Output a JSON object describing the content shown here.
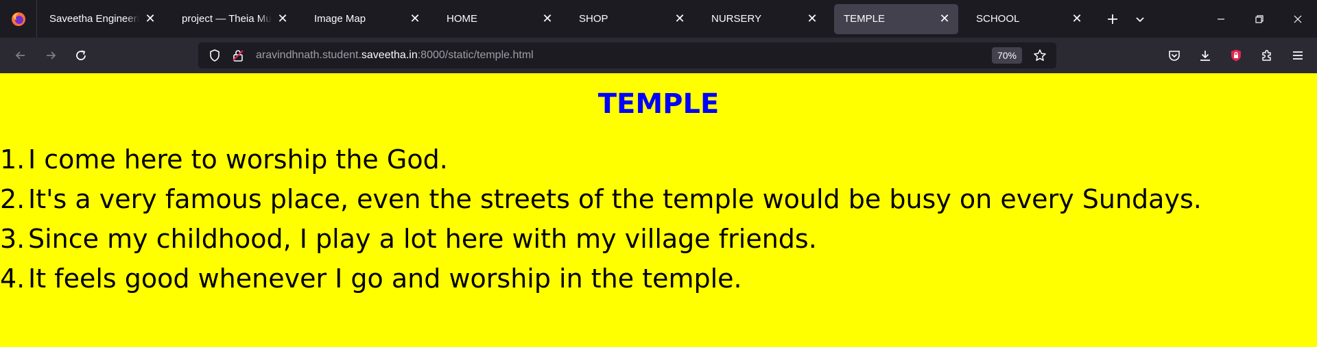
{
  "browser": {
    "tabs": [
      {
        "label": "Saveetha Engineering",
        "active": false
      },
      {
        "label": "project — Theia Multi-",
        "active": false
      },
      {
        "label": "Image Map",
        "active": false
      },
      {
        "label": "HOME",
        "active": false
      },
      {
        "label": "SHOP",
        "active": false
      },
      {
        "label": "NURSERY",
        "active": false
      },
      {
        "label": "TEMPLE",
        "active": true
      },
      {
        "label": "SCHOOL",
        "active": false
      }
    ],
    "url": {
      "prefix": "aravindhnath.student.",
      "host": "saveetha.in",
      "suffix": ":8000/static/temple.html"
    },
    "zoom": "70%"
  },
  "page": {
    "title": "TEMPLE",
    "items": [
      {
        "num": "1.",
        "text": "I come here to worship the God."
      },
      {
        "num": "2.",
        "text": "It's a very famous place, even the streets of the temple would be busy on every Sundays."
      },
      {
        "num": "3.",
        "text": "Since my childhood, I play a lot here with my village friends."
      },
      {
        "num": "4.",
        "text": "It feels good whenever I go and worship in the temple."
      }
    ]
  },
  "colors": {
    "page_background": "#ffff00",
    "title_color": "#0000ff",
    "text_color": "#000000",
    "tabbar_background": "#1c1b22",
    "navbar_background": "#2b2a33",
    "active_tab": "#42414d"
  }
}
